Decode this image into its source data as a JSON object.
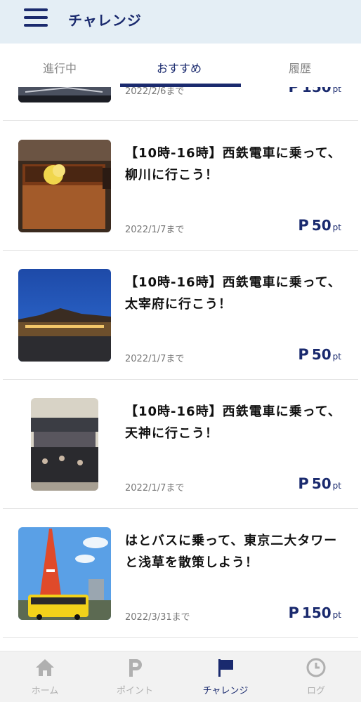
{
  "header": {
    "title": "チャレンジ",
    "menu_icon": "hamburger-menu-icon"
  },
  "tabs": [
    {
      "label": "進行中",
      "active": false
    },
    {
      "label": "おすすめ",
      "active": true
    },
    {
      "label": "履歴",
      "active": false
    }
  ],
  "challenges": [
    {
      "title": "",
      "deadline": "2022/2/6まで",
      "points": "150",
      "unit": "pt"
    },
    {
      "title": "【10時-16時】西鉄電車に乗って、柳川に行こう！",
      "deadline": "2022/1/7まで",
      "points": "50",
      "unit": "pt"
    },
    {
      "title": "【10時-16時】西鉄電車に乗って、太宰府に行こう！",
      "deadline": "2022/1/7まで",
      "points": "50",
      "unit": "pt"
    },
    {
      "title": "【10時-16時】西鉄電車に乗って、天神に行こう！",
      "deadline": "2022/1/7まで",
      "points": "50",
      "unit": "pt"
    },
    {
      "title": "はとバスに乗って、東京二大タワーと浅草を散策しよう！",
      "deadline": "2022/3/31まで",
      "points": "150",
      "unit": "pt"
    }
  ],
  "point_symbol": "P",
  "bottom_nav": [
    {
      "label": "ホーム",
      "icon": "home-icon",
      "active": false
    },
    {
      "label": "ポイント",
      "icon": "point-icon",
      "active": false
    },
    {
      "label": "チャレンジ",
      "icon": "flag-icon",
      "active": true
    },
    {
      "label": "ログ",
      "icon": "clock-icon",
      "active": false
    }
  ],
  "colors": {
    "primary": "#1a2a6e",
    "header_bg": "#e4eef5",
    "inactive": "#b0b0b0"
  }
}
